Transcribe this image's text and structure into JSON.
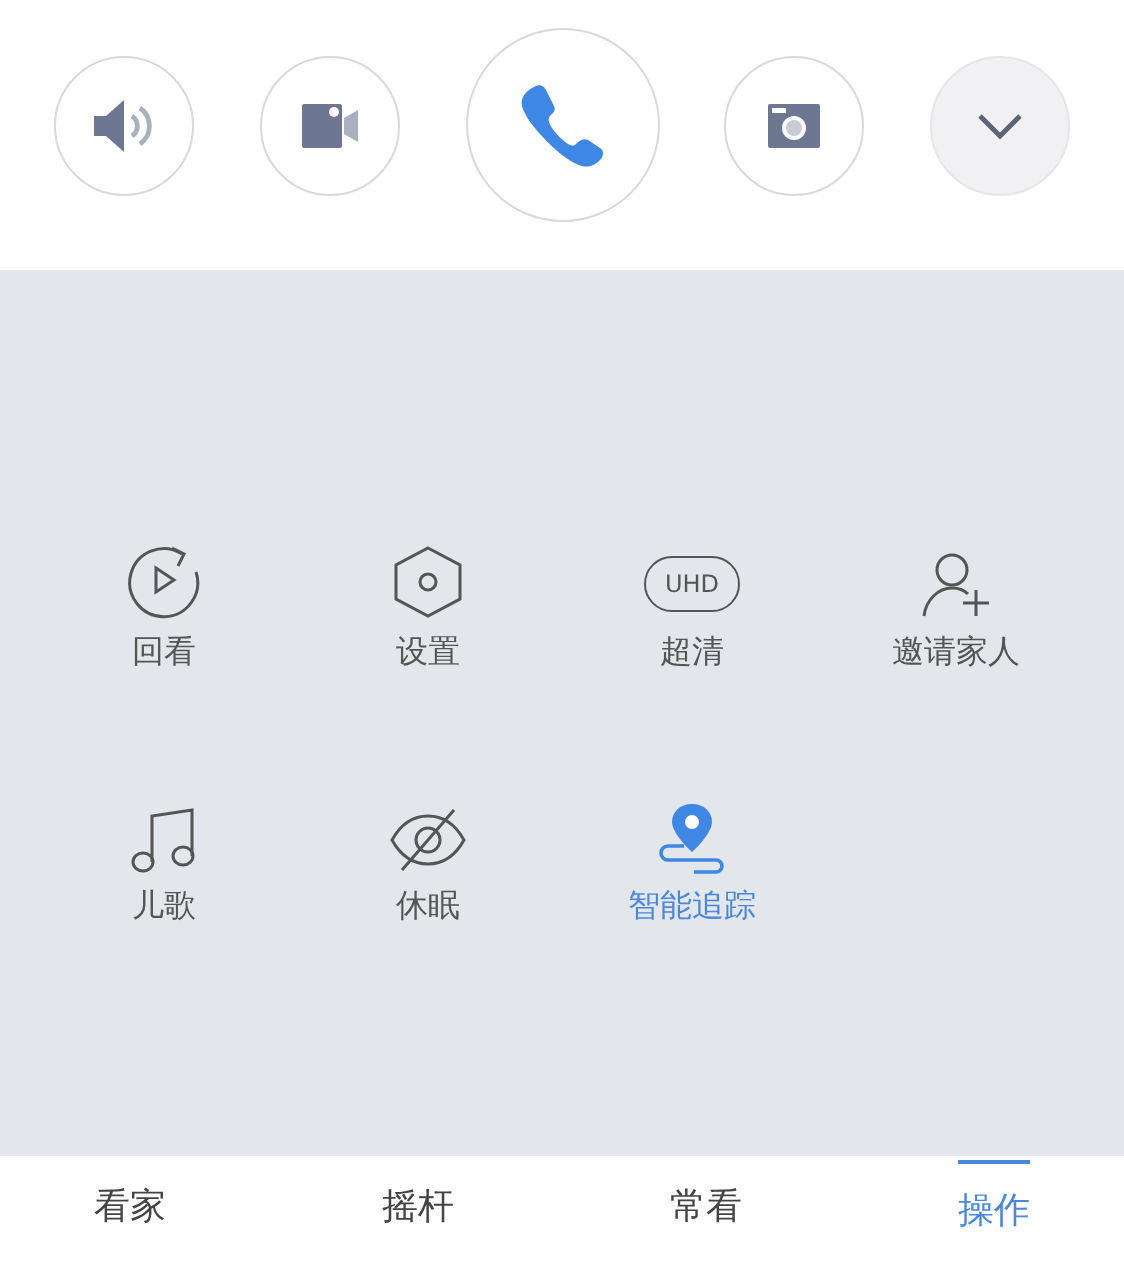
{
  "controls": [
    {
      "kind": "speaker"
    },
    {
      "kind": "video"
    },
    {
      "kind": "phone"
    },
    {
      "kind": "camera"
    },
    {
      "kind": "chevron"
    }
  ],
  "actions": [
    {
      "kind": "replay",
      "label": "回看",
      "on": false
    },
    {
      "kind": "settings",
      "label": "设置",
      "on": false
    },
    {
      "kind": "uhd",
      "badge": "UHD",
      "label": "超清",
      "on": false
    },
    {
      "kind": "invite",
      "label": "邀请家人",
      "on": false
    },
    {
      "kind": "music",
      "label": "儿歌",
      "on": false
    },
    {
      "kind": "sleep",
      "label": "休眠",
      "on": false
    },
    {
      "kind": "track",
      "label": "智能追踪",
      "on": true
    }
  ],
  "tabs": [
    {
      "label": "看家",
      "selected": false
    },
    {
      "label": "摇杆",
      "selected": false
    },
    {
      "label": "常看",
      "selected": false
    },
    {
      "label": "操作",
      "selected": true
    }
  ]
}
